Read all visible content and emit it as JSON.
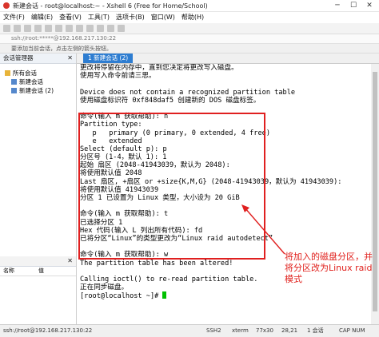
{
  "window": {
    "title": "新建会话 - root@localhost:~ - Xshell 6 (Free for Home/School)"
  },
  "menu": [
    "文件(F)",
    "编辑(E)",
    "查看(V)",
    "工具(T)",
    "选项卡(B)",
    "窗口(W)",
    "帮助(H)"
  ],
  "address": "ssh://root:*****@192.168.217.130:22",
  "hint": "要添加当前会话，点击左侧的箭头按钮。",
  "sidebar": {
    "header": "会话管理器",
    "tree": [
      "所有会话",
      "新建会话",
      "新建会话 (2)"
    ],
    "props_header": "",
    "props_cols": [
      "名称",
      "值"
    ]
  },
  "tab": {
    "label": "1 新建会话 (2)"
  },
  "terminal": {
    "lines": [
      "更改将停留在内存中，直到您决定将更改写入磁盘。",
      "使用写入命令前请三思。",
      "",
      "Device does not contain a recognized partition table",
      "使用磁盘标识符 0xf848daf5 创建新的 DOS 磁盘标签。",
      "",
      "命令(输入 m 获取帮助): n",
      "Partition type:",
      "   p   primary (0 primary, 0 extended, 4 free)",
      "   e   extended",
      "Select (default p): p",
      "分区号 (1-4，默认 1): 1",
      "起始 扇区 (2048-41943039，默认为 2048):",
      "将使用默认值 2048",
      "Last 扇区, +扇区 or +size{K,M,G} (2048-41943039，默认为 41943039):",
      "将使用默认值 41943039",
      "分区 1 已设置为 Linux 类型，大小设为 20 GiB",
      "",
      "命令(输入 m 获取帮助): t",
      "已选择分区 1",
      "Hex 代码(输入 L 列出所有代码): fd",
      "已将分区“Linux”的类型更改为“Linux raid autodetect”",
      "",
      "命令(输入 m 获取帮助): w",
      "The partition table has been altered!",
      "",
      "Calling ioctl() to re-read partition table.",
      "正在同步磁盘。"
    ],
    "prompt": "[root@localhost ~]# "
  },
  "annotation": "将加入的磁盘分区，并将分区改为Linux raid模式",
  "status": {
    "conn": "ssh://root@192.168.217.130:22",
    "proto": "SSH2",
    "term": "xterm",
    "size": "77x30",
    "pos": "28,21",
    "sessions": "1 会话",
    "caps": "CAP NUM"
  },
  "colors": {
    "highlight": "#e02020",
    "tab": "#2e7dd1",
    "cursor": "#00c000"
  }
}
